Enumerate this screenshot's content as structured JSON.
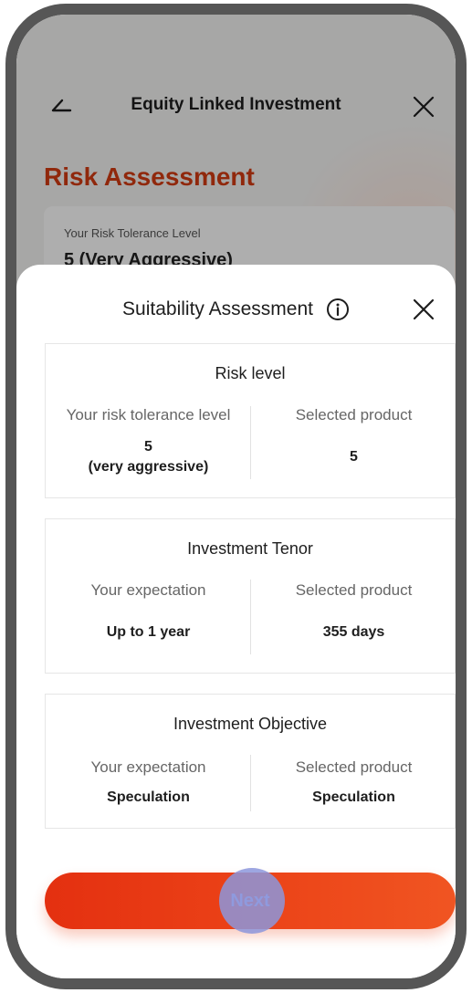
{
  "header": {
    "title": "Equity Linked Investment",
    "back_icon": "back-arrow-icon",
    "close_icon": "close-icon"
  },
  "background": {
    "heading": "Risk Assessment",
    "card_label": "Your Risk Tolerance Level",
    "card_value": "5 (Very Aggressive)"
  },
  "sheet": {
    "title": "Suitability Assessment",
    "info_icon": "info-icon",
    "close_icon": "close-icon",
    "cards": [
      {
        "title": "Risk level",
        "left_label": "Your risk tolerance level",
        "left_value": "5",
        "left_value_sub": "(very aggressive)",
        "right_label": "Selected product",
        "right_value": "5"
      },
      {
        "title": "Investment Tenor",
        "left_label": "Your expectation",
        "left_value": "Up to 1 year",
        "right_label": "Selected product",
        "right_value": "355 days"
      },
      {
        "title": "Investment Objective",
        "left_label": "Your expectation",
        "left_value": "Speculation",
        "right_label": "Selected product",
        "right_value": "Speculation"
      }
    ],
    "next_label": "Next"
  },
  "colors": {
    "accent": "#e9401a",
    "heading": "#cf3a12",
    "frame": "#565656"
  }
}
